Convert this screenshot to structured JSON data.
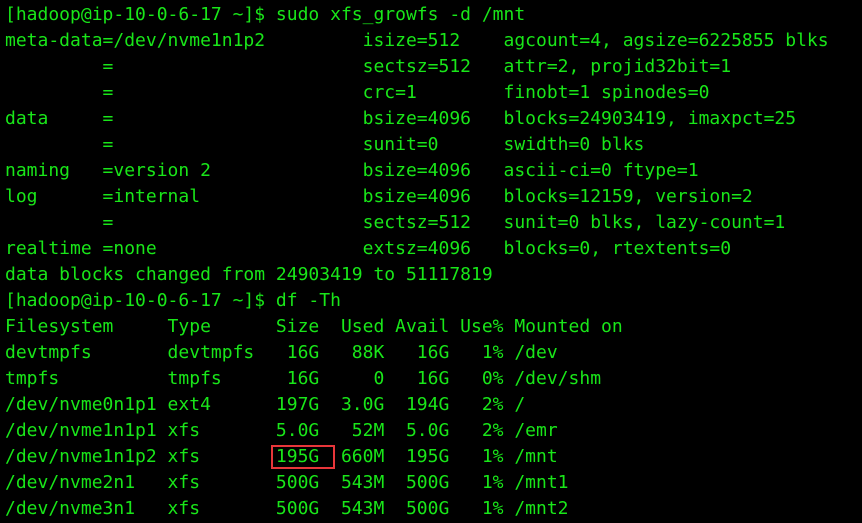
{
  "terminal": {
    "text_color": "#19e619",
    "background": "#000000",
    "highlight_color": "#e8363a",
    "lines": [
      "[hadoop@ip-10-0-6-17 ~]$ sudo xfs_growfs -d /mnt",
      "meta-data=/dev/nvme1n1p2         isize=512    agcount=4, agsize=6225855 blks",
      "         =                       sectsz=512   attr=2, projid32bit=1",
      "         =                       crc=1        finobt=1 spinodes=0",
      "data     =                       bsize=4096   blocks=24903419, imaxpct=25",
      "         =                       sunit=0      swidth=0 blks",
      "naming   =version 2              bsize=4096   ascii-ci=0 ftype=1",
      "log      =internal               bsize=4096   blocks=12159, version=2",
      "         =                       sectsz=512   sunit=0 blks, lazy-count=1",
      "realtime =none                   extsz=4096   blocks=0, rtextents=0",
      "data blocks changed from 24903419 to 51117819",
      "[hadoop@ip-10-0-6-17 ~]$ df -Th",
      "Filesystem     Type      Size  Used Avail Use% Mounted on",
      "devtmpfs       devtmpfs   16G   88K   16G   1% /dev",
      "tmpfs          tmpfs      16G     0   16G   0% /dev/shm",
      "/dev/nvme0n1p1 ext4      197G  3.0G  194G   2% /",
      "/dev/nvme1n1p1 xfs       5.0G   52M  5.0G   2% /emr",
      "/dev/nvme1n1p2 xfs       195G  660M  195G   1% /mnt",
      "/dev/nvme2n1   xfs       500G  543M  500G   1% /mnt1",
      "/dev/nvme3n1   xfs       500G  543M  500G   1% /mnt2"
    ]
  }
}
